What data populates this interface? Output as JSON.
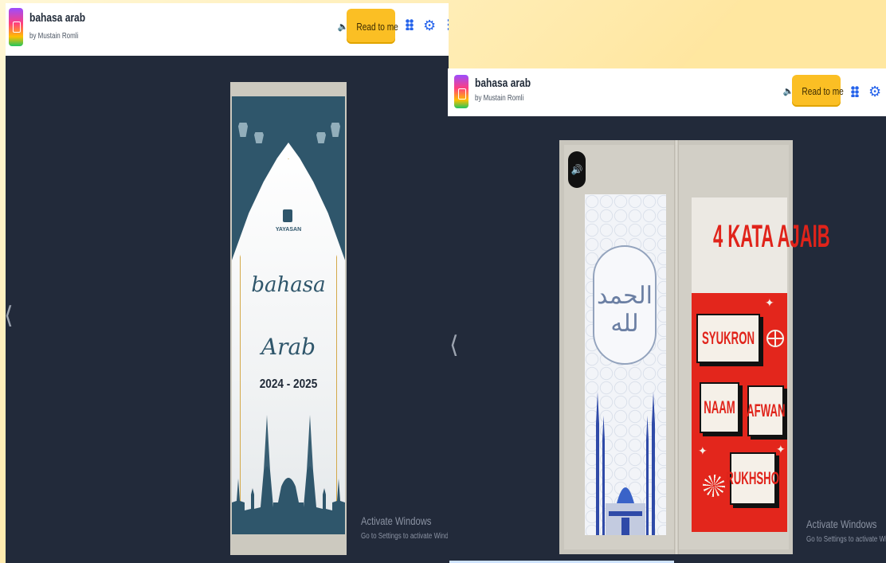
{
  "app": {
    "title": "bahasa arab",
    "author": "by Mustain Romli",
    "read_label": "Read to me"
  },
  "icons": {
    "speaker": "speaker-icon",
    "grid": "grid-icon",
    "settings": "gear-icon",
    "more": "more-vertical-icon",
    "prev": "chevron-left-icon"
  },
  "colors": {
    "read_button": "#fbbf24",
    "icon_blue": "#2563eb",
    "viewer_bg": "#222a3a",
    "cover_teal": "#2f566b",
    "title_red": "#e0231a"
  },
  "cover": {
    "foundation": "YAYASAN",
    "script_line1": "bahasa",
    "script_line2": "Arab",
    "year": "2024 - 2025"
  },
  "spread": {
    "title": "4 KATA AJAIB",
    "words": [
      "SYUKRON",
      "NAAM",
      "AFWAN",
      "RUKHSHO"
    ],
    "calligraphy": "الحمد لله"
  },
  "watermark": {
    "line1": "Activate Windows",
    "line2": "Go to Settings to activate Windows."
  }
}
